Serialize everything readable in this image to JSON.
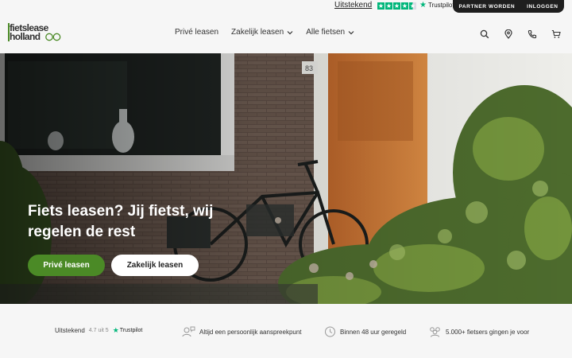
{
  "topbar": {
    "rating_text": "Uitstekend",
    "trustpilot_label": "Trustpilot",
    "partner_label": "PARTNER WORDEN",
    "login_label": "INLOGGEN"
  },
  "header": {
    "logo_line1": "fietslease",
    "logo_line2": "holland",
    "nav": [
      {
        "label": "Privé leasen"
      },
      {
        "label": "Zakelijk leasen"
      },
      {
        "label": "Alle fietsen"
      }
    ],
    "icons": [
      "search-icon",
      "location-pin-icon",
      "phone-icon",
      "cart-icon"
    ]
  },
  "hero": {
    "title": "Fiets leasen? Jij fietst, wij regelen de rest",
    "house_number": "83",
    "primary_cta": "Privé leasen",
    "secondary_cta": "Zakelijk leasen"
  },
  "usp": {
    "rating_label": "Uitstekend",
    "rating_score": "4.7 uit 5",
    "trustpilot_label": "Trustpilot",
    "items": [
      {
        "icon": "person-chat-icon",
        "text": "Altijd een persoonlijk aanspreekpunt"
      },
      {
        "icon": "clock-icon",
        "text": "Binnen 48 uur geregeld"
      },
      {
        "icon": "group-icon",
        "text": "5.000+ fietsers gingen je voor"
      }
    ]
  },
  "colors": {
    "brand_green": "#4b8a26",
    "trustpilot_green": "#00b67a",
    "dark": "#1e1e1e"
  }
}
